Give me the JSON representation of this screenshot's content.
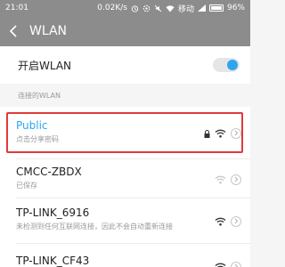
{
  "status_bar": {
    "time": "21:01",
    "speed": "0.02K/s",
    "carrier": "移动",
    "battery": "96%",
    "battery_level": 0.96
  },
  "header": {
    "title": "WLAN"
  },
  "wlan_toggle": {
    "label": "开启WLAN",
    "on": true,
    "accent_color": "#2ea6ef"
  },
  "connected_section": {
    "label": "连接的WLAN"
  },
  "networks": [
    {
      "name": "Public",
      "subtitle": "点击分享密码",
      "locked": true,
      "highlighted": true,
      "name_color": "#2ea6ef"
    },
    {
      "name": "CMCC-ZBDX",
      "subtitle": "已保存",
      "locked": false
    },
    {
      "name": "TP-LINK_6916",
      "subtitle": "未检测到任何互联网连接，因此不会自动重新连接",
      "locked": false
    },
    {
      "name": "TP-LINK_CF43",
      "subtitle": "",
      "locked": false
    }
  ],
  "colors": {
    "highlight_border": "#e03a3a",
    "title_bar": "#8c8c8c"
  }
}
